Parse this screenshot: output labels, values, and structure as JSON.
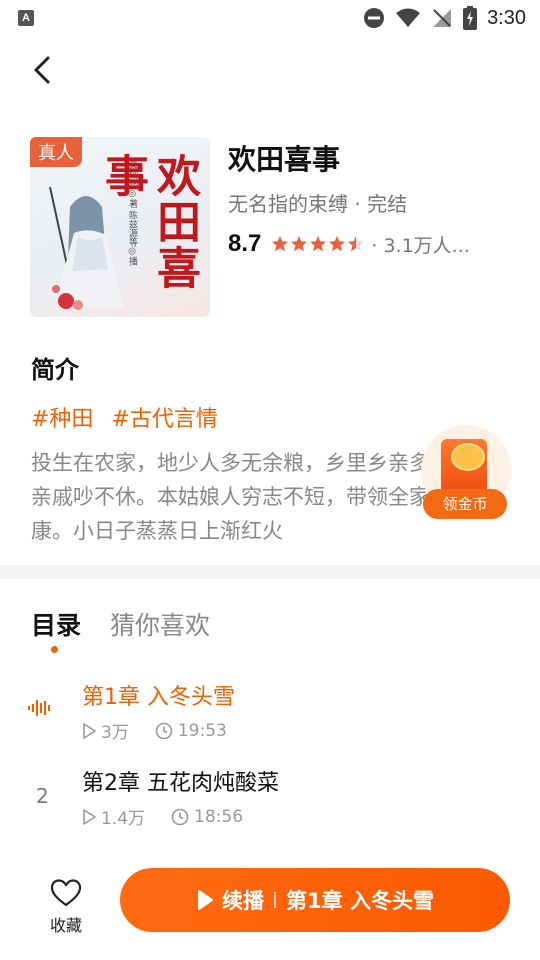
{
  "status_bar": {
    "time": "3:30",
    "left_icon_letter": "A"
  },
  "book": {
    "cover_tag": "真人",
    "cover_title": "欢田喜事",
    "cover_subtext": "夏杨澜 ◎著 陈兹源等◎播",
    "title": "欢田喜事",
    "subline": "无名指的束缚 · 完结",
    "score": "8.7",
    "stars_rating": 4.5,
    "readers": "· 3.1万人..."
  },
  "intro": {
    "heading": "简介",
    "tags": [
      "#种田",
      "#古代言情"
    ],
    "description": "投生在农家，地少人多无余粮，乡里乡亲多，远近亲戚吵不休。本姑娘人穷志不短，带领全家奔小康。小日子蒸蒸日上渐红火"
  },
  "coin_widget": {
    "label": "领金币"
  },
  "tabs": {
    "catalog": "目录",
    "recommend": "猜你喜欢"
  },
  "chapters": [
    {
      "index": "",
      "title": "第1章 入冬头雪",
      "plays": "3万",
      "duration": "19:53",
      "playing": true
    },
    {
      "index": "2",
      "title": "第2章 五花肉炖酸菜",
      "plays": "1.4万",
      "duration": "18:56",
      "playing": false
    }
  ],
  "bottom": {
    "favorite_label": "收藏",
    "continue_label": "续播",
    "continue_chapter": "第1章 入冬头雪"
  },
  "colors": {
    "accent": "#f06000",
    "cover_tag": "#e8613a"
  }
}
